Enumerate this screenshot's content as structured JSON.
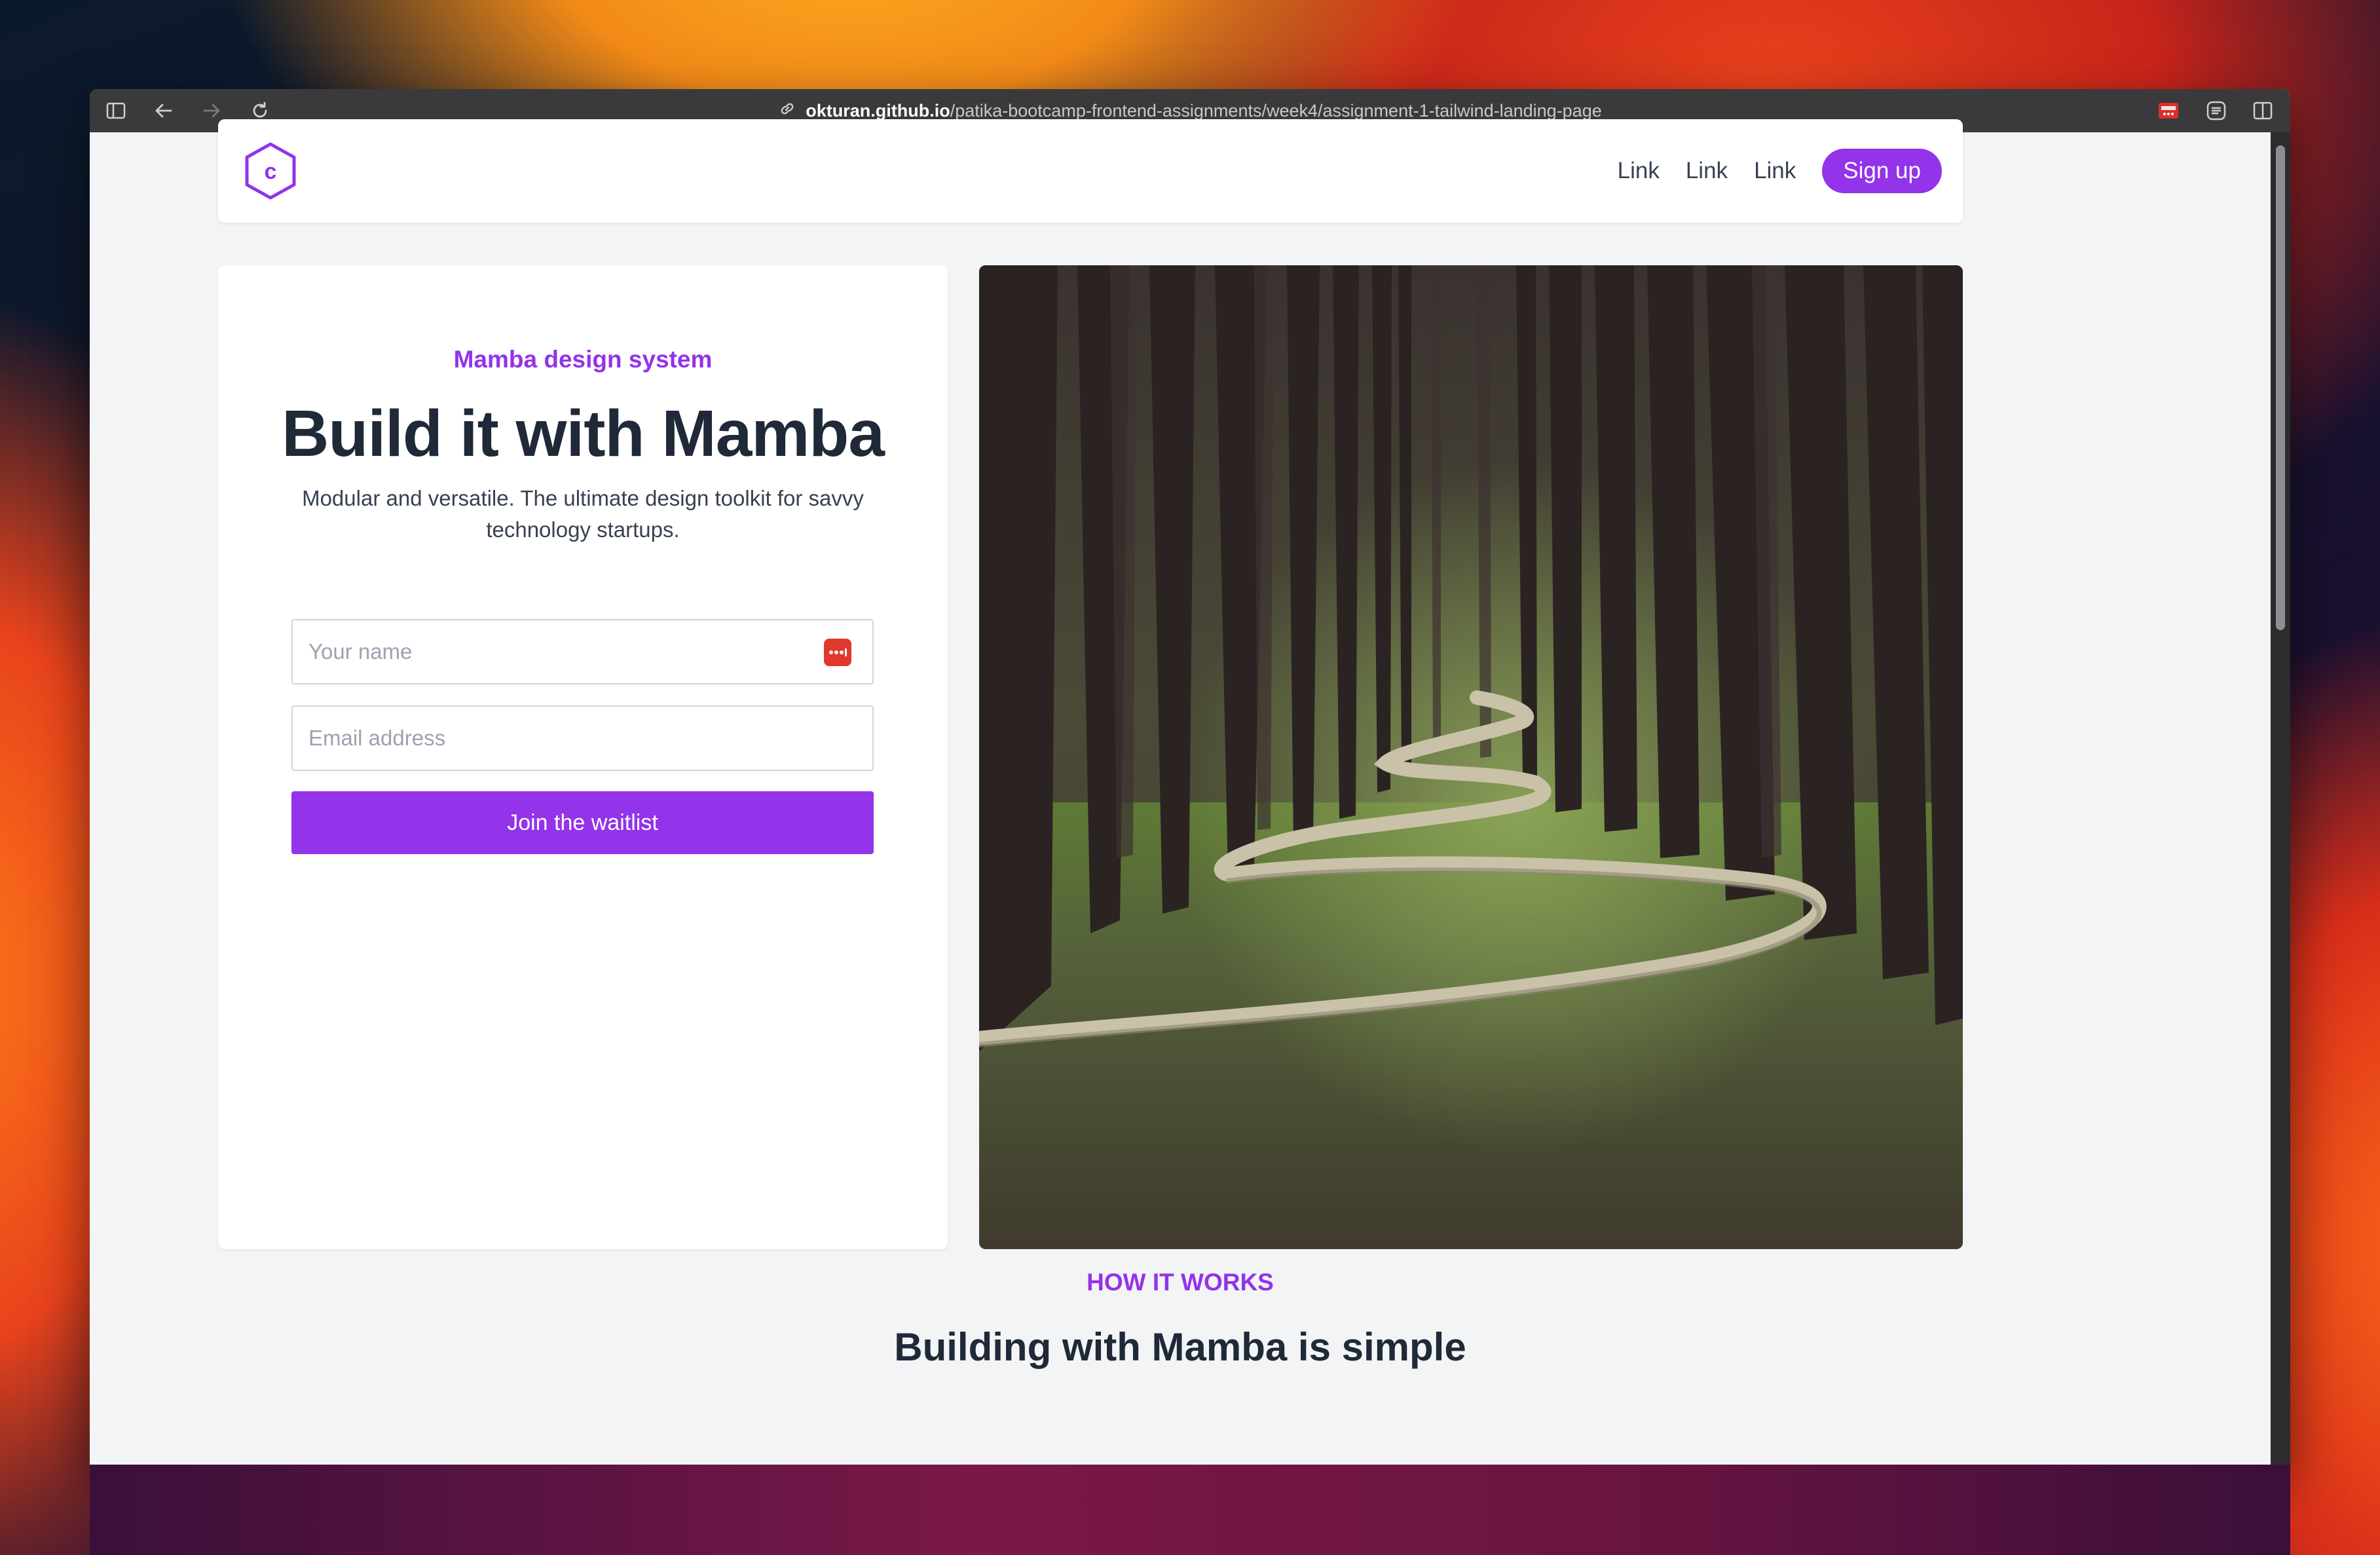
{
  "browser": {
    "url_host": "okturan.github.io",
    "url_path": "/patika-bootcamp-frontend-assignments/week4/assignment-1-tailwind-landing-page",
    "icons": [
      "sidebar-icon",
      "back-icon",
      "forward-icon",
      "reload-icon",
      "link-icon",
      "extension-icon",
      "reader-icon",
      "split-view-icon"
    ]
  },
  "nav": {
    "logo_letter": "c",
    "links": [
      "Link",
      "Link",
      "Link"
    ],
    "signup_label": "Sign up"
  },
  "hero": {
    "eyebrow": "Mamba design system",
    "title": "Build it with Mamba",
    "subtitle": "Modular and versatile. The ultimate design toolkit for savvy technology startups.",
    "name_placeholder": "Your name",
    "email_placeholder": "Email address",
    "cta_label": "Join the waitlist"
  },
  "section": {
    "eyebrow": "HOW IT WORKS",
    "title": "Building with Mamba is simple"
  },
  "colors": {
    "accent": "#9333ea",
    "heading": "#1f2937",
    "page_bg": "#f3f4f6"
  }
}
